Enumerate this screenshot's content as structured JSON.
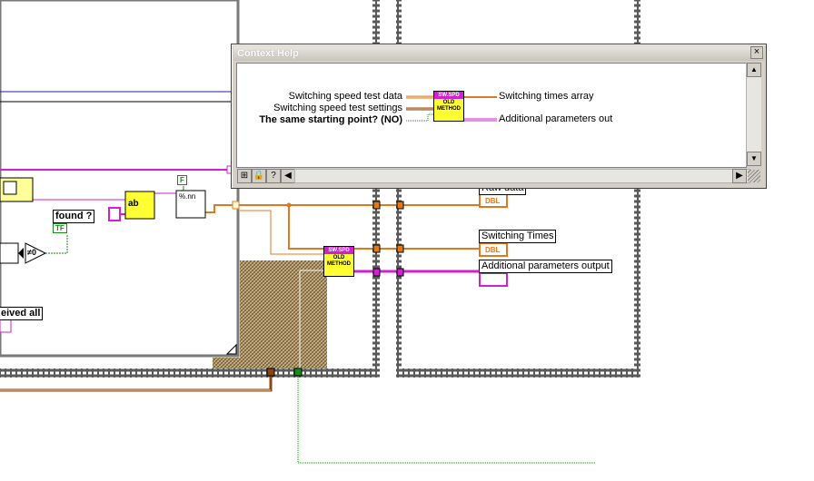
{
  "window": {
    "title": "Context Help",
    "close_glyph": "×"
  },
  "help": {
    "vi_icon": {
      "top": "SW.SPD",
      "line1": "OLD",
      "line2": "METHOD"
    },
    "inputs": [
      "Switching speed test data",
      "Switching speed test settings",
      "The same starting point? (NO)"
    ],
    "outputs": [
      "Switching times array",
      "Additional parameters out"
    ],
    "toolbar_icons": [
      "show-detail-icon",
      "lock-icon",
      "help-icon"
    ],
    "help_glyph": "?"
  },
  "diagram": {
    "found_label": "found ?",
    "found_indicator": "TF",
    "bool_constant": "F",
    "received_label": "eived all",
    "zero_compare": "≠0",
    "vi_icon": {
      "top": "SW.SPD",
      "line1": "OLD",
      "line2": "METHOD"
    },
    "raw_data_label": "Raw data",
    "raw_data_type": "DBL",
    "switching_times_label": "Switching Times",
    "switching_times_type": "DBL",
    "additional_params_label": "Additional parameters output",
    "concat_label": "ab",
    "format_label": "%.nn"
  },
  "colors": {
    "orange_wire": "#e07820",
    "pink_wire": "#d020d0",
    "brown_wire": "#8b4513",
    "green_wire": "#1a8a1a",
    "blue_wire": "#1c1cb4",
    "frame_gray": "#7a7a7a",
    "vi_yellow": "#ffff33",
    "hatch_brown": "#a08050"
  }
}
